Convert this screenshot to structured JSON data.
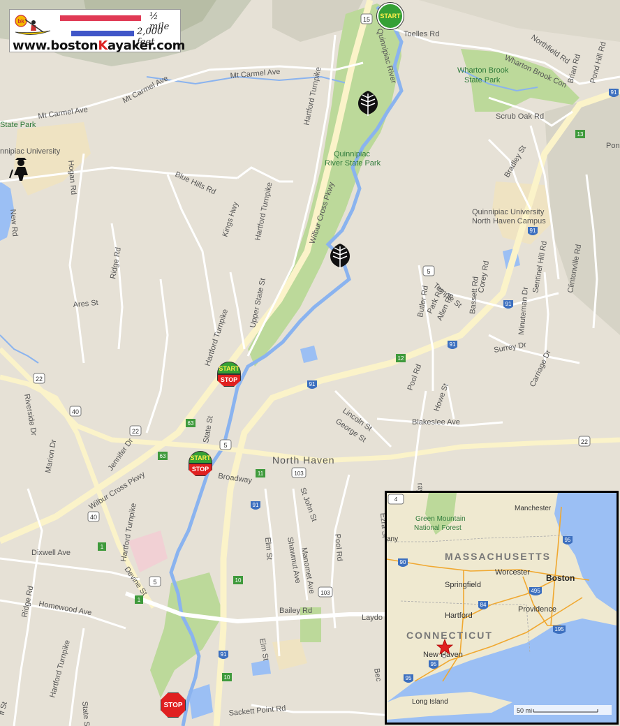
{
  "legend": {
    "logo_text": "bk",
    "scale_mile": "½ mile",
    "scale_feet": "2,000 feet",
    "url_prefix": "www.boston",
    "url_k": "K",
    "url_suffix": "ayaker.com"
  },
  "markers": {
    "start_top": "START",
    "start_stop_1_a": "START",
    "start_stop_1_b": "STOP",
    "start_stop_2_a": "START",
    "start_stop_2_b": "STOP",
    "stop_bottom": "STOP"
  },
  "labels": {
    "toelles_rd": "Toelles Rd",
    "quinnipiac_river": "Quinnipiac River",
    "northfield_rd": "Northfield Rd",
    "wharton_brook_con": "Wharton Brook Con",
    "brian_rd": "Brian Rd",
    "pond_hill_rd": "Pond Hill Rd",
    "wharton_brook_park_1": "Wharton Brook",
    "wharton_brook_park_2": "State Park",
    "mt_carmel_ave_1": "Mt Carmel Ave",
    "mt_carmel_ave_2": "Mt Carmel Ave",
    "mt_carmel_ave_3": "Mt Carmel Ave",
    "state_park_frag": "State Park",
    "hartford_tpke_1": "Hartford Turnpike",
    "scrub_oak_rd": "Scrub Oak Rd",
    "quinnipiac_university": "nnipiac University",
    "hogan_rd": "Hogan Rd",
    "qrsp_1": "Quinnipiac",
    "qrsp_2": "River State Park",
    "bradley_st": "Bradley St",
    "blue_hills_rd": "Blue Hills Rd",
    "wilbur_cross_pkwy_1": "Wilbur Cross Pkwy",
    "kings_hwy": "Kings Hwy",
    "hartford_tpke_2": "Hartford Turnpike",
    "new_rd": "New Rd",
    "qu_nh_1": "Quinnipiac University",
    "qu_nh_2": "North Haven Campus",
    "ridge_rd_1": "Ridge Rd",
    "upper_state_st": "Upper State St",
    "butler_rd": "Butler Rd",
    "temple_st": "Temple St",
    "park_rd": "Park Rd",
    "allen_rd": "Allen Rd",
    "corey_rd": "Corey Rd",
    "bassett_rd": "Bassett Rd",
    "sentinel_hill_rd": "Sentinel Hill Rd",
    "minuteman_dr": "Minuteman Dr",
    "clintonville_rd": "Clintonville Rd",
    "ares_st": "Ares St",
    "hartford_tpke_3": "Hartford Turnpike",
    "surrey_dr": "Surrey Dr",
    "carriage_dr": "Carriage Dr",
    "pool_rd_1": "Pool Rd",
    "howe_st": "Howe St",
    "riverside_dr": "Riverside Dr",
    "lincoln_st": "Lincoln St",
    "george_st": "George St",
    "blakeslee_ave": "Blakeslee Ave",
    "state_st_1": "State St",
    "jennifer_dr": "Jennifer Dr",
    "marion_dr": "Marion Dr",
    "wilbur_cross_pkwy_2": "Wilbur Cross Pkwy",
    "north_haven": "North Haven",
    "broadway": "Broadway",
    "st_john_st": "St John St",
    "hartford_tpke_4": "Hartford Turnpike",
    "ezra_st": "Ezra St",
    "elm_st_1": "Elm St",
    "shawmut_ave": "Shawmut Ave",
    "manomet_ave": "Manomet Ave",
    "pool_rd_2": "Pool Rd",
    "dixwell_ave": "Dixwell Ave",
    "devine_st": "Devine St",
    "ridge_rd_2": "Ridge Rd",
    "homewood_ave": "Homewood Ave",
    "bailey_rd": "Bailey Rd",
    "laydon": "Laydo",
    "elm_st_2": "Elm St",
    "hartford_tpke_5": "Hartford Turnpike",
    "state_st_2": "State St",
    "sackett_point_rd": "Sackett Point Rd",
    "ff_st": "ff St",
    "ponc": "Ponc",
    "bec": "Bec",
    "ray": "ray"
  },
  "shields": {
    "r15": "15",
    "r91a": "91",
    "r13": "13",
    "r91b": "91",
    "r5a": "5",
    "r91c": "91",
    "r91d": "91",
    "r12": "12",
    "r91e": "91",
    "r22a": "22",
    "r40a": "40",
    "r63a": "63",
    "r22b": "22",
    "r5b": "5",
    "r63b": "63",
    "r11": "11",
    "r103a": "103",
    "r91f": "91",
    "r40b": "40",
    "r1a": "1",
    "r5c": "5",
    "r10": "10",
    "r1b": "1",
    "r103b": "103",
    "r91g": "91",
    "r22c": "22",
    "r10b": "10"
  },
  "inset": {
    "mountain_1": "Green Mountain",
    "mountain_2": "National Forest",
    "manchester": "Manchester",
    "massachusetts": "MASSACHUSETTS",
    "albany_frag": "any",
    "worcester": "Worcester",
    "boston": "Boston",
    "springfield": "Springfield",
    "hartford": "Hartford",
    "providence": "Providence",
    "connecticut": "CONNECTICUT",
    "new_haven": "New Haven",
    "long_island": "Long Island",
    "scale": "50 mi",
    "i90": "90",
    "i95a": "95",
    "i495": "495",
    "i84": "84",
    "i195": "195",
    "i95b": "95",
    "i95c": "95",
    "r4": "4"
  },
  "colors": {
    "land": "#e6e1d6",
    "park": "#bcd99a",
    "water": "#9bbff4",
    "road": "#ffffff",
    "highway": "#fbf3c9",
    "interstate_shield": "#3c6fbf",
    "state_shield": "#3f9a3c",
    "start_marker": "#35a035",
    "stop_marker": "#e02020"
  }
}
